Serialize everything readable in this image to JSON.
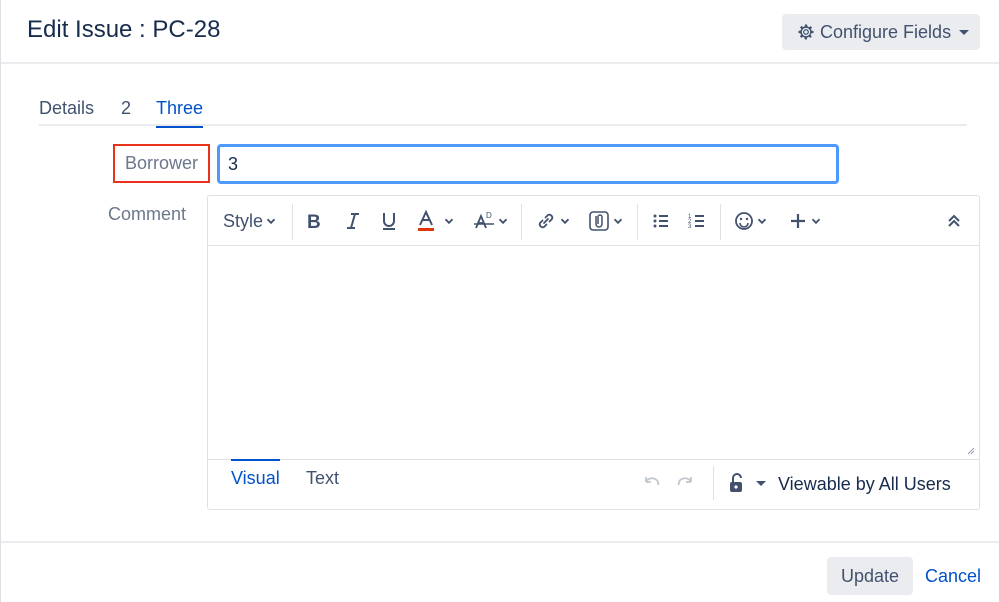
{
  "header": {
    "title": "Edit Issue : PC-28",
    "configure_label": "Configure Fields"
  },
  "tabs": [
    {
      "label": "Details"
    },
    {
      "label": "2"
    },
    {
      "label": "Three"
    }
  ],
  "active_tab": "Three",
  "form": {
    "borrower_label": "Borrower",
    "borrower_value": "3",
    "comment_label": "Comment"
  },
  "editor": {
    "toolbar": {
      "style_label": "Style",
      "icons": [
        "bold-icon",
        "italic-icon",
        "underline-icon",
        "text-color-icon",
        "text-effects-icon",
        "link-icon",
        "attachment-icon",
        "bullet-list-icon",
        "numbered-list-icon",
        "emoji-icon",
        "insert-more-icon",
        "collapse-toolbar-icon"
      ],
      "text_color_accent": "#DE350B"
    },
    "modes": [
      {
        "label": "Visual"
      },
      {
        "label": "Text"
      }
    ],
    "active_mode": "Visual",
    "visibility_label": "Viewable by All Users"
  },
  "footer": {
    "update_label": "Update",
    "cancel_label": "Cancel"
  },
  "colors": {
    "accent": "#0052CC",
    "focus_border": "#4C9AFF",
    "highlight_box": "#E8321C",
    "button_bg": "#EBECF0"
  }
}
